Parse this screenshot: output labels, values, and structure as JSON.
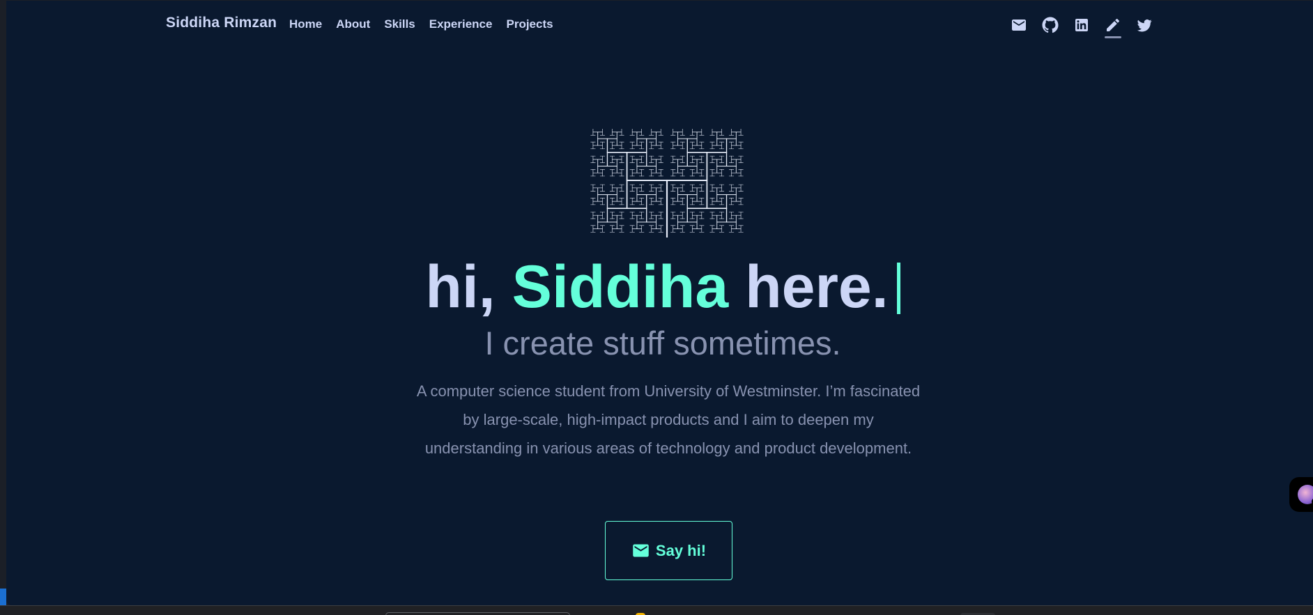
{
  "nav": {
    "brand": "Siddiha Rimzan",
    "links": [
      "Home",
      "About",
      "Skills",
      "Experience",
      "Projects"
    ],
    "icons": [
      "mail-icon",
      "github-icon",
      "linkedin-icon",
      "pen-icon",
      "twitter-icon"
    ],
    "active_icon": "pen-icon"
  },
  "hero": {
    "greeting": "hi,",
    "name": "Siddiha",
    "suffix": "here.",
    "tagline": "I create stuff sometimes.",
    "description": "A computer science student from University of Westminster. I’m fascinated by large-scale, high-impact products and I aim to deepen my understanding in various areas of technology and product development.",
    "cta_label": "Say hi!",
    "cta_icon": "mail-icon"
  },
  "colors": {
    "background": "#0a192f",
    "accent": "#64ffda",
    "heading": "#ccd6f6",
    "muted": "#8892b0"
  }
}
